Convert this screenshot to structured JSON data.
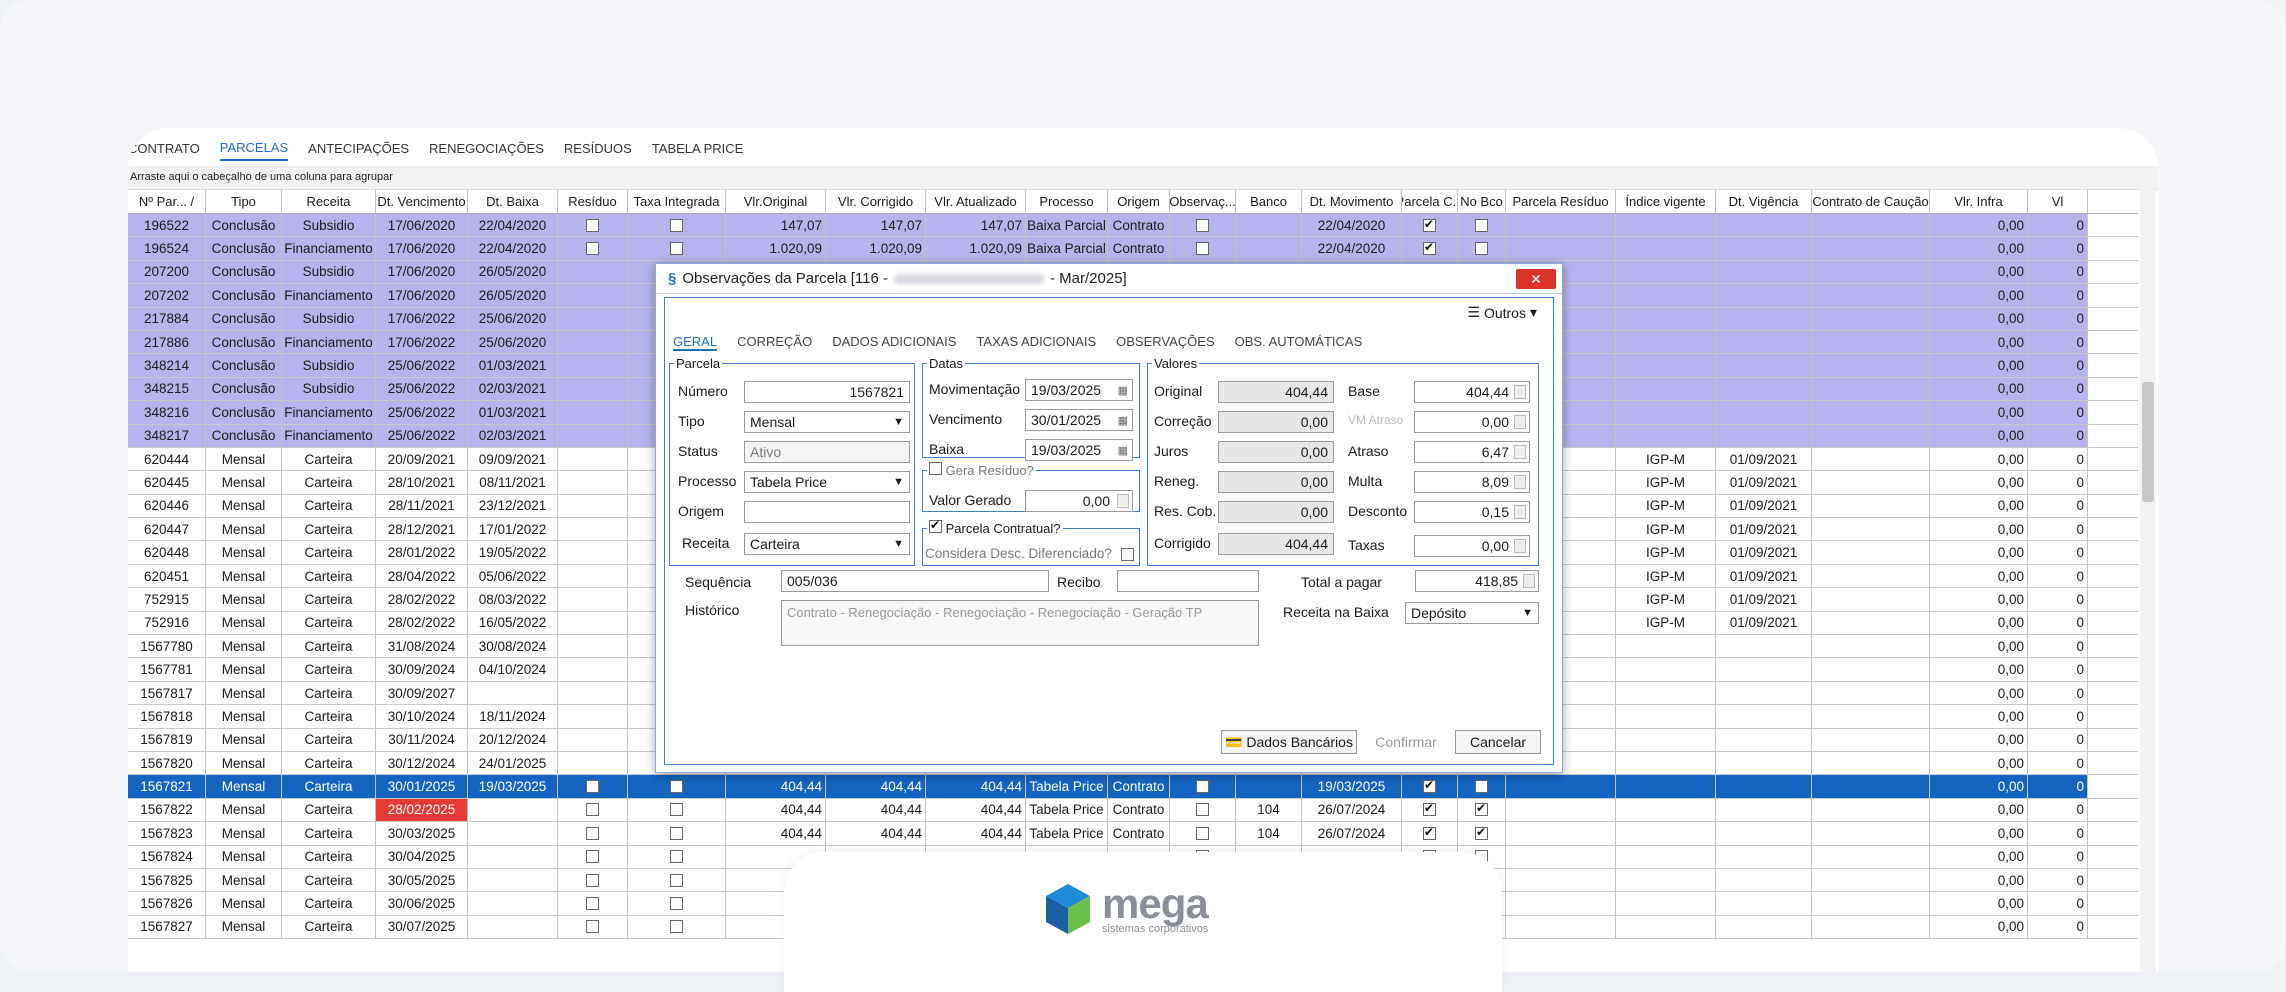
{
  "tabs": [
    "CONTRATO",
    "PARCELAS",
    "ANTECIPAÇÕES",
    "RENEGOCIAÇÕES",
    "RESÍDUOS",
    "TABELA PRICE"
  ],
  "group_hint": "Arraste aqui o cabeçalho de uma coluna para agrupar",
  "columns": [
    "Nº Par... /",
    "Tipo",
    "Receita",
    "Dt. Vencimento",
    "Dt. Baixa",
    "Resíduo",
    "Taxa Integrada",
    "Vlr.Original",
    "Vlr. Corrigido",
    "Vlr. Atualizado",
    "Processo",
    "Origem",
    "Observaç...",
    "Banco",
    "Dt. Movimento",
    "Parcela C...",
    "No Bco",
    "Parcela Resíduo",
    "Índice vigente",
    "Dt. Vigência",
    "Contrato de Caução",
    "Vlr. Infra",
    "Vl"
  ],
  "rows": [
    {
      "n": "196522",
      "tipo": "Conclusão",
      "rec": "Subsidio",
      "venc": "17/06/2020",
      "baixa": "22/04/2020",
      "res": false,
      "tax": false,
      "orig": "147,07",
      "corr": "147,07",
      "atu": "147,07",
      "proc": "Baixa Parcial",
      "ori": "Contrato",
      "obs": false,
      "banco": "",
      "mov": "22/04/2020",
      "pc": true,
      "nb": false,
      "pr": "",
      "ind": "",
      "vig": "",
      "cau": "",
      "infra": "0,00",
      "vl": "0",
      "style": "hl"
    },
    {
      "n": "196524",
      "tipo": "Conclusão",
      "rec": "Financiamento",
      "venc": "17/06/2020",
      "baixa": "22/04/2020",
      "res": false,
      "tax": false,
      "orig": "1.020,09",
      "corr": "1.020,09",
      "atu": "1.020,09",
      "proc": "Baixa Parcial",
      "ori": "Contrato",
      "obs": false,
      "banco": "",
      "mov": "22/04/2020",
      "pc": true,
      "nb": false,
      "pr": "",
      "ind": "",
      "vig": "",
      "cau": "",
      "infra": "0,00",
      "vl": "0",
      "style": "hl"
    },
    {
      "n": "207200",
      "tipo": "Conclusão",
      "rec": "Subsidio",
      "venc": "17/06/2020",
      "baixa": "26/05/2020",
      "infra": "0,00",
      "vl": "0",
      "style": "hl"
    },
    {
      "n": "207202",
      "tipo": "Conclusão",
      "rec": "Financiamento",
      "venc": "17/06/2020",
      "baixa": "26/05/2020",
      "infra": "0,00",
      "vl": "0",
      "style": "hl"
    },
    {
      "n": "217884",
      "tipo": "Conclusão",
      "rec": "Subsidio",
      "venc": "17/06/2022",
      "baixa": "25/06/2020",
      "infra": "0,00",
      "vl": "0",
      "style": "hl"
    },
    {
      "n": "217886",
      "tipo": "Conclusão",
      "rec": "Financiamento",
      "venc": "17/06/2022",
      "baixa": "25/06/2020",
      "infra": "0,00",
      "vl": "0",
      "style": "hl"
    },
    {
      "n": "348214",
      "tipo": "Conclusão",
      "rec": "Subsidio",
      "venc": "25/06/2022",
      "baixa": "01/03/2021",
      "infra": "0,00",
      "vl": "0",
      "style": "hl"
    },
    {
      "n": "348215",
      "tipo": "Conclusão",
      "rec": "Subsidio",
      "venc": "25/06/2022",
      "baixa": "02/03/2021",
      "infra": "0,00",
      "vl": "0",
      "style": "hl"
    },
    {
      "n": "348216",
      "tipo": "Conclusão",
      "rec": "Financiamento",
      "venc": "25/06/2022",
      "baixa": "01/03/2021",
      "infra": "0,00",
      "vl": "0",
      "style": "hl"
    },
    {
      "n": "348217",
      "tipo": "Conclusão",
      "rec": "Financiamento",
      "venc": "25/06/2022",
      "baixa": "02/03/2021",
      "infra": "0,00",
      "vl": "0",
      "style": "hl"
    },
    {
      "n": "620444",
      "tipo": "Mensal",
      "rec": "Carteira",
      "venc": "20/09/2021",
      "baixa": "09/09/2021",
      "ind": "IGP-M",
      "vig": "01/09/2021",
      "infra": "0,00",
      "vl": "0",
      "style": "wh"
    },
    {
      "n": "620445",
      "tipo": "Mensal",
      "rec": "Carteira",
      "venc": "28/10/2021",
      "baixa": "08/11/2021",
      "ind": "IGP-M",
      "vig": "01/09/2021",
      "infra": "0,00",
      "vl": "0",
      "style": "wh"
    },
    {
      "n": "620446",
      "tipo": "Mensal",
      "rec": "Carteira",
      "venc": "28/11/2021",
      "baixa": "23/12/2021",
      "ind": "IGP-M",
      "vig": "01/09/2021",
      "infra": "0,00",
      "vl": "0",
      "style": "wh"
    },
    {
      "n": "620447",
      "tipo": "Mensal",
      "rec": "Carteira",
      "venc": "28/12/2021",
      "baixa": "17/01/2022",
      "ind": "IGP-M",
      "vig": "01/09/2021",
      "infra": "0,00",
      "vl": "0",
      "style": "wh"
    },
    {
      "n": "620448",
      "tipo": "Mensal",
      "rec": "Carteira",
      "venc": "28/01/2022",
      "baixa": "19/05/2022",
      "ind": "IGP-M",
      "vig": "01/09/2021",
      "infra": "0,00",
      "vl": "0",
      "style": "wh"
    },
    {
      "n": "620451",
      "tipo": "Mensal",
      "rec": "Carteira",
      "venc": "28/04/2022",
      "baixa": "05/06/2022",
      "ind": "IGP-M",
      "vig": "01/09/2021",
      "infra": "0,00",
      "vl": "0",
      "style": "wh"
    },
    {
      "n": "752915",
      "tipo": "Mensal",
      "rec": "Carteira",
      "venc": "28/02/2022",
      "baixa": "08/03/2022",
      "ind": "IGP-M",
      "vig": "01/09/2021",
      "infra": "0,00",
      "vl": "0",
      "style": "wh"
    },
    {
      "n": "752916",
      "tipo": "Mensal",
      "rec": "Carteira",
      "venc": "28/02/2022",
      "baixa": "16/05/2022",
      "ind": "IGP-M",
      "vig": "01/09/2021",
      "infra": "0,00",
      "vl": "0",
      "style": "wh"
    },
    {
      "n": "1567780",
      "tipo": "Mensal",
      "rec": "Carteira",
      "venc": "31/08/2024",
      "baixa": "30/08/2024",
      "infra": "0,00",
      "vl": "0",
      "style": "wh"
    },
    {
      "n": "1567781",
      "tipo": "Mensal",
      "rec": "Carteira",
      "venc": "30/09/2024",
      "baixa": "04/10/2024",
      "infra": "0,00",
      "vl": "0",
      "style": "wh"
    },
    {
      "n": "1567817",
      "tipo": "Mensal",
      "rec": "Carteira",
      "venc": "30/09/2027",
      "baixa": "",
      "infra": "0,00",
      "vl": "0",
      "style": "wh"
    },
    {
      "n": "1567818",
      "tipo": "Mensal",
      "rec": "Carteira",
      "venc": "30/10/2024",
      "baixa": "18/11/2024",
      "infra": "0,00",
      "vl": "0",
      "style": "wh"
    },
    {
      "n": "1567819",
      "tipo": "Mensal",
      "rec": "Carteira",
      "venc": "30/11/2024",
      "baixa": "20/12/2024",
      "infra": "0,00",
      "vl": "0",
      "style": "wh"
    },
    {
      "n": "1567820",
      "tipo": "Mensal",
      "rec": "Carteira",
      "venc": "30/12/2024",
      "baixa": "24/01/2025",
      "infra": "0,00",
      "vl": "0",
      "style": "wh"
    },
    {
      "n": "1567821",
      "tipo": "Mensal",
      "rec": "Carteira",
      "venc": "30/01/2025",
      "baixa": "19/03/2025",
      "orig": "404,44",
      "corr": "404,44",
      "atu": "404,44",
      "proc": "Tabela Price",
      "ori": "Contrato",
      "mov": "19/03/2025",
      "pc": true,
      "nb": false,
      "infra": "0,00",
      "vl": "0",
      "style": "sel"
    },
    {
      "n": "1567822",
      "tipo": "Mensal",
      "rec": "Carteira",
      "venc": "28/02/2025",
      "baixa": "",
      "orig": "404,44",
      "corr": "404,44",
      "atu": "404,44",
      "proc": "Tabela Price",
      "ori": "Contrato",
      "banco": "104",
      "mov": "26/07/2024",
      "pc": true,
      "nb": true,
      "infra": "0,00",
      "vl": "0",
      "style": "wh",
      "red": true
    },
    {
      "n": "1567823",
      "tipo": "Mensal",
      "rec": "Carteira",
      "venc": "30/03/2025",
      "baixa": "",
      "orig": "404,44",
      "corr": "404,44",
      "atu": "404,44",
      "proc": "Tabela Price",
      "ori": "Contrato",
      "banco": "104",
      "mov": "26/07/2024",
      "pc": true,
      "nb": true,
      "infra": "0,00",
      "vl": "0",
      "style": "wh"
    },
    {
      "n": "1567824",
      "tipo": "Mensal",
      "rec": "Carteira",
      "venc": "30/04/2025",
      "baixa": "",
      "infra": "0,00",
      "vl": "0",
      "style": "wh"
    },
    {
      "n": "1567825",
      "tipo": "Mensal",
      "rec": "Carteira",
      "venc": "30/05/2025",
      "baixa": "",
      "infra": "0,00",
      "vl": "0",
      "style": "wh"
    },
    {
      "n": "1567826",
      "tipo": "Mensal",
      "rec": "Carteira",
      "venc": "30/06/2025",
      "baixa": "",
      "infra": "0,00",
      "vl": "0",
      "style": "wh"
    },
    {
      "n": "1567827",
      "tipo": "Mensal",
      "rec": "Carteira",
      "venc": "30/07/2025",
      "baixa": "",
      "infra": "0,00",
      "vl": "0",
      "style": "wh"
    }
  ],
  "dialog": {
    "title_prefix": "Observações da Parcela [116 -",
    "title_suffix": "- Mar/2025]",
    "close": "✕",
    "outros": "Outros",
    "tabs": [
      "GERAL",
      "CORREÇÃO",
      "DADOS ADICIONAIS",
      "TAXAS ADICIONAIS",
      "OBSERVAÇÕES",
      "OBS. AUTOMÁTICAS"
    ],
    "parcela": {
      "legend": "Parcela",
      "numero_label": "Número",
      "numero": "1567821",
      "tipo_label": "Tipo",
      "tipo": "Mensal",
      "status_label": "Status",
      "status": "Ativo",
      "processo_label": "Processo",
      "processo": "Tabela Price",
      "origem_label": "Origem",
      "origem": "",
      "receita_label": "Receita",
      "receita": "Carteira"
    },
    "datas": {
      "legend": "Datas",
      "mov_label": "Movimentação",
      "mov": "19/03/2025",
      "venc_label": "Vencimento",
      "venc": "30/01/2025",
      "baixa_label": "Baixa",
      "baixa": "19/03/2025"
    },
    "residuo": {
      "legend": "Gera Resíduo?",
      "valor_label": "Valor Gerado",
      "valor": "0,00"
    },
    "contratual": {
      "legend": "Parcela Contratual?",
      "desc_label": "Considera Desc. Diferenciado?"
    },
    "valores": {
      "legend": "Valores",
      "original_label": "Original",
      "original": "404,44",
      "correcao_label": "Correção",
      "correcao": "0,00",
      "juros_label": "Juros",
      "juros": "0,00",
      "reneg_label": "Reneg.",
      "reneg": "0,00",
      "rescob_label": "Res. Cob.",
      "rescob": "0,00",
      "corrigido_label": "Corrigido",
      "corrigido": "404,44",
      "base_label": "Base",
      "base": "404,44",
      "vmatraso_label": "VM Atraso",
      "vmatraso": "0,00",
      "atraso_label": "Atraso",
      "atraso": "6,47",
      "multa_label": "Multa",
      "multa": "8,09",
      "desconto_label": "Desconto",
      "desconto": "0,15",
      "taxas_label": "Taxas",
      "taxas": "0,00"
    },
    "sequencia_label": "Sequência",
    "sequencia": "005/036",
    "recibo_label": "Recibo",
    "recibo": "",
    "total_label": "Total a pagar",
    "total": "418,85",
    "historico_label": "Histórico",
    "historico": "Contrato - Renegociação - Renegociação - Renegociação - Geração TP",
    "receita_baixa_label": "Receita na Baixa",
    "receita_baixa": "Depósito",
    "btn_dados": "Dados Bancários",
    "btn_confirmar": "Confirmar",
    "btn_cancelar": "Cancelar"
  },
  "footer": {
    "brand": "mega",
    "tagline": "sistemas corporativos"
  }
}
